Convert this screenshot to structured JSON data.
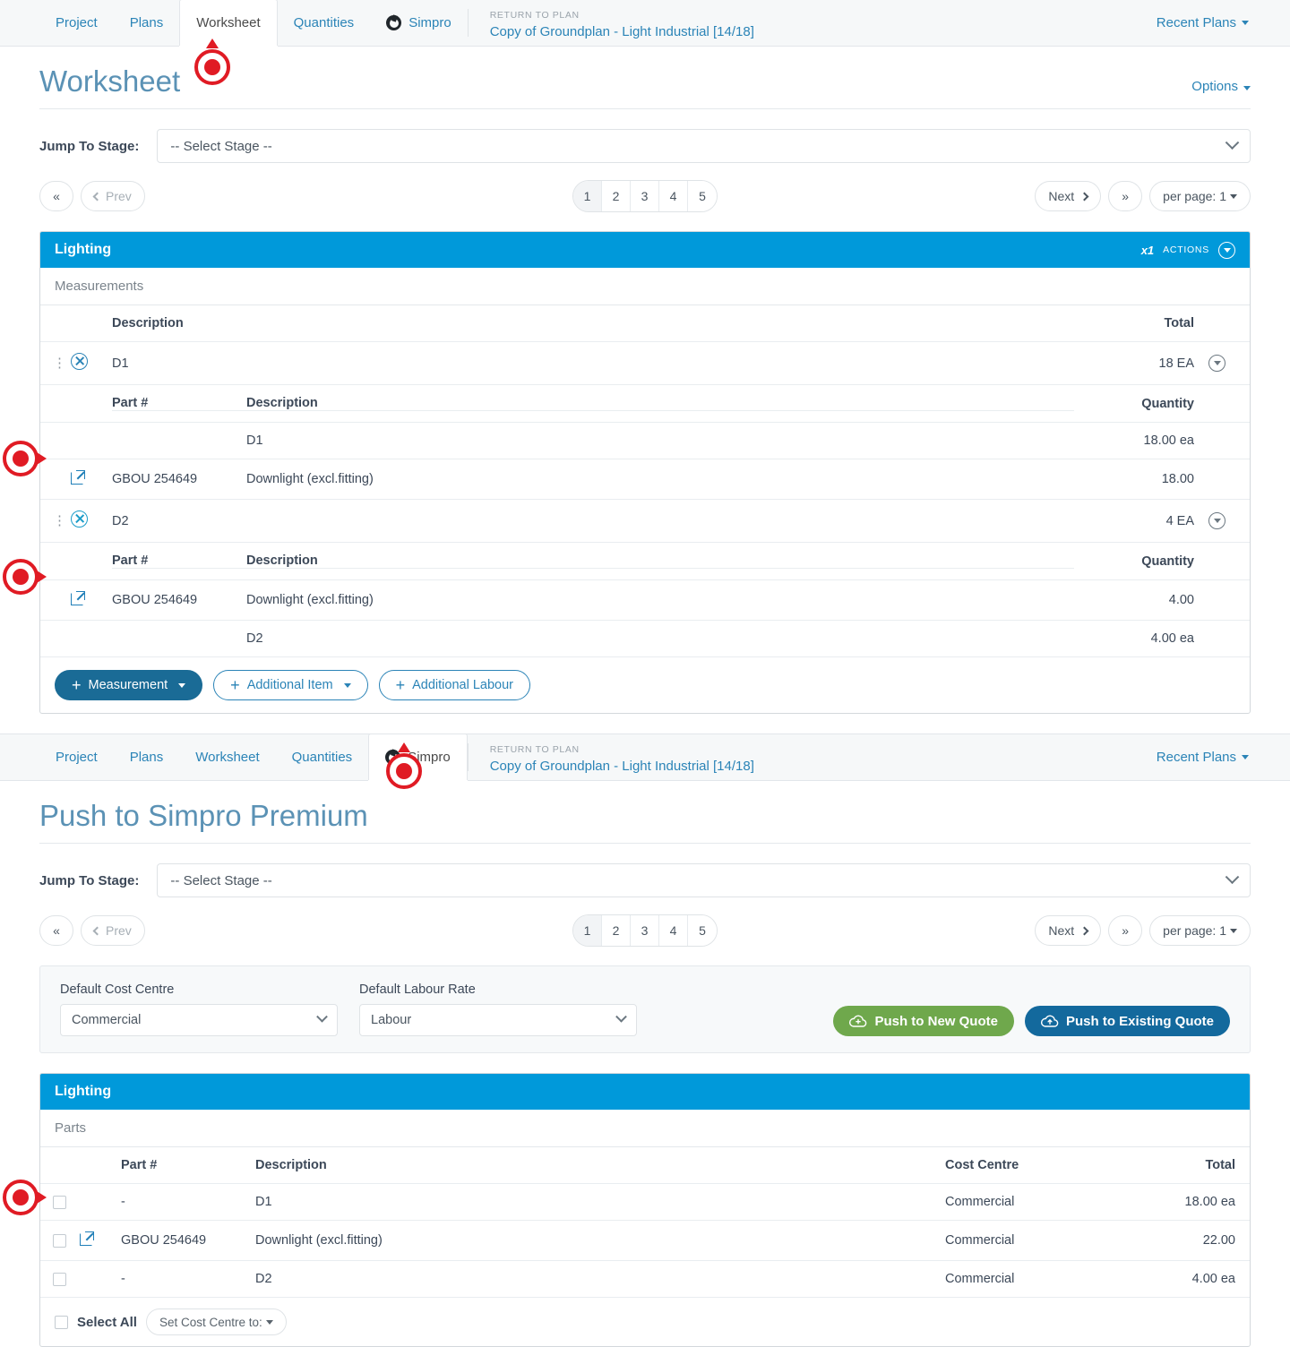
{
  "nav": {
    "tabs": [
      {
        "label": "Project",
        "icon": null,
        "active": false
      },
      {
        "label": "Plans",
        "icon": null,
        "active": false
      },
      {
        "label": "Worksheet",
        "icon": null,
        "active": true
      },
      {
        "label": "Quantities",
        "icon": null,
        "active": false
      },
      {
        "label": "Simpro",
        "icon": "simpro-logo-icon",
        "active": false
      }
    ],
    "return_label": "RETURN TO PLAN",
    "plan_name": "Copy of Groundplan - Light Industrial [14/18]",
    "recent_plans": "Recent Plans"
  },
  "nav2": {
    "tabs": [
      {
        "label": "Project",
        "icon": null,
        "active": false
      },
      {
        "label": "Plans",
        "icon": null,
        "active": false
      },
      {
        "label": "Worksheet",
        "icon": null,
        "active": false
      },
      {
        "label": "Quantities",
        "icon": null,
        "active": false
      },
      {
        "label": "Simpro",
        "icon": "simpro-logo-icon",
        "active": true
      }
    ],
    "return_label": "RETURN TO PLAN",
    "plan_name": "Copy of Groundplan - Light Industrial [14/18]",
    "recent_plans": "Recent Plans"
  },
  "worksheet": {
    "title": "Worksheet",
    "options_label": "Options",
    "stage_label": "Jump To Stage:",
    "stage_value": "-- Select Stage --",
    "pager": {
      "first": "«",
      "prev": "Prev",
      "pages": [
        "1",
        "2",
        "3",
        "4",
        "5"
      ],
      "active_page": "1",
      "next": "Next",
      "last": "»",
      "per_page": "per page: 1"
    },
    "panel": {
      "title": "Lighting",
      "multiplier": "x1",
      "actions_label": "ACTIONS",
      "subhead": "Measurements",
      "columns": {
        "description": "Description",
        "total": "Total"
      },
      "sub_columns": {
        "part": "Part #",
        "description": "Description",
        "quantity": "Quantity"
      },
      "groups": [
        {
          "name": "D1",
          "total": "18 EA",
          "rows": [
            {
              "part": "",
              "description": "D1",
              "quantity": "18.00 ea",
              "has_link": false
            },
            {
              "part": "GBOU 254649",
              "description": "Downlight (excl.fitting)",
              "quantity": "18.00",
              "has_link": true
            }
          ]
        },
        {
          "name": "D2",
          "total": "4 EA",
          "rows": [
            {
              "part": "GBOU 254649",
              "description": "Downlight (excl.fitting)",
              "quantity": "4.00",
              "has_link": true
            },
            {
              "part": "",
              "description": "D2",
              "quantity": "4.00 ea",
              "has_link": false
            }
          ]
        }
      ],
      "footer_buttons": [
        {
          "label": "Measurement",
          "style": "primary",
          "caret": true
        },
        {
          "label": "Additional Item",
          "style": "outline",
          "caret": true
        },
        {
          "label": "Additional Labour",
          "style": "outline",
          "caret": false
        }
      ]
    }
  },
  "simpro": {
    "title": "Push to Simpro Premium",
    "stage_label": "Jump To Stage:",
    "stage_value": "-- Select Stage --",
    "pager": {
      "first": "«",
      "prev": "Prev",
      "pages": [
        "1",
        "2",
        "3",
        "4",
        "5"
      ],
      "active_page": "1",
      "next": "Next",
      "last": "»",
      "per_page": "per page: 1"
    },
    "options": {
      "cost_centre_label": "Default Cost Centre",
      "cost_centre_value": "Commercial",
      "labour_rate_label": "Default Labour Rate",
      "labour_rate_value": "Labour",
      "push_new": "Push to New Quote",
      "push_existing": "Push to Existing Quote"
    },
    "panel": {
      "title": "Lighting",
      "subhead": "Parts",
      "columns": {
        "part": "Part #",
        "description": "Description",
        "cost_centre": "Cost Centre",
        "total": "Total"
      },
      "rows": [
        {
          "part": "-",
          "description": "D1",
          "cost_centre": "Commercial",
          "total": "18.00 ea",
          "has_link": false
        },
        {
          "part": "GBOU 254649",
          "description": "Downlight (excl.fitting)",
          "cost_centre": "Commercial",
          "total": "22.00",
          "has_link": true
        },
        {
          "part": "-",
          "description": "D2",
          "cost_centre": "Commercial",
          "total": "4.00 ea",
          "has_link": false
        }
      ],
      "select_all": "Select All",
      "set_cost_centre": "Set Cost Centre to:"
    }
  },
  "colors": {
    "panel_header": "#0099da",
    "link": "#2b84b7",
    "title": "#5b92b5",
    "push_new": "#6fa84c",
    "push_existing": "#13699d",
    "marker": "#e01b24"
  }
}
